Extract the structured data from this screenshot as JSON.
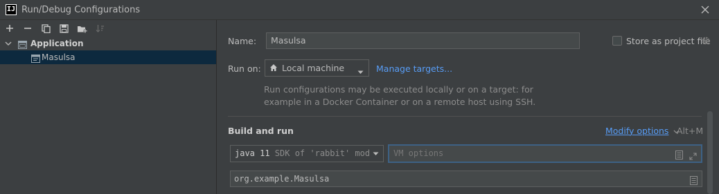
{
  "window": {
    "title": "Run/Debug Configurations",
    "logo_text": "IJ"
  },
  "tree": {
    "group_label": "Application",
    "item_label": "Masulsa"
  },
  "form": {
    "name_label": "Name:",
    "name_value": "Masulsa",
    "store_label": "Store as project file",
    "run_on_label": "Run on:",
    "run_on_value": "Local machine",
    "manage_targets": "Manage targets...",
    "desc_line1": "Run configurations may be executed locally or on a target: for",
    "desc_line2": "example in a Docker Container or on a remote host using SSH.",
    "build_run_title": "Build and run",
    "modify_options": "Modify options",
    "modify_shortcut": "Alt+M",
    "jdk_strong": "java 11",
    "jdk_detail": " SDK of 'rabbit' modu",
    "vm_placeholder": "VM options",
    "main_class_value": "org.example.Masulsa"
  },
  "colors": {
    "accent": "#589df6",
    "selection": "#0d293e",
    "focus": "#3d6185"
  }
}
